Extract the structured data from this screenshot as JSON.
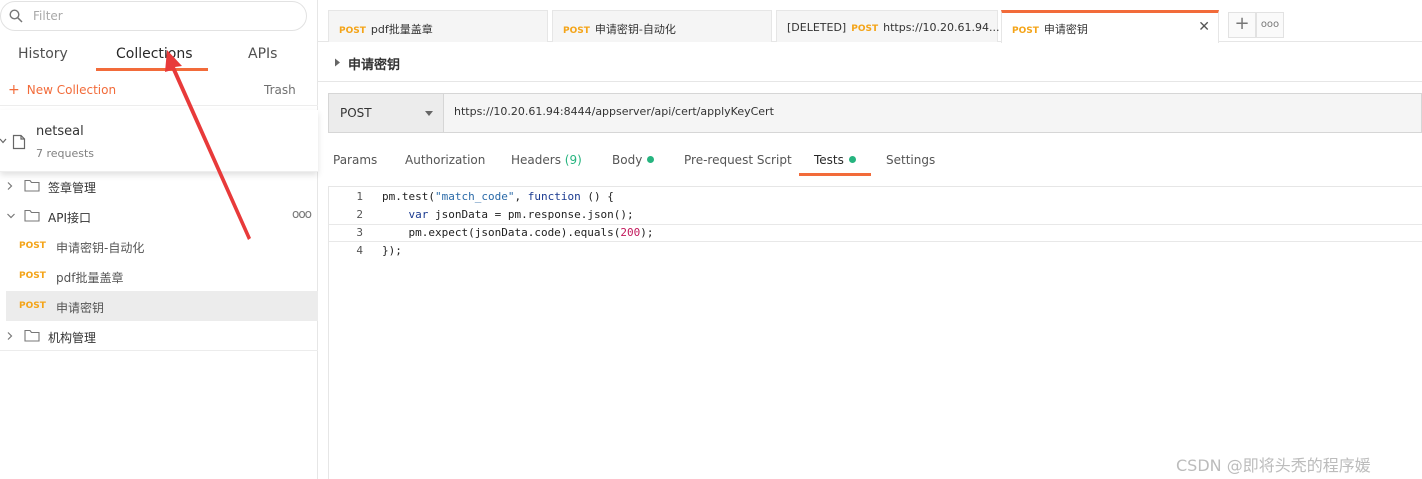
{
  "sidebar": {
    "filter_placeholder": "Filter",
    "tabs": [
      {
        "label": "History"
      },
      {
        "label": "Collections"
      },
      {
        "label": "APIs"
      }
    ],
    "new_collection_label": "New Collection",
    "trash_label": "Trash",
    "collection": {
      "name": "netseal",
      "count": "7 requests"
    },
    "tree": [
      {
        "label": "签章管理"
      },
      {
        "label": "API接口",
        "more": "ooo"
      },
      {
        "label": "机构管理"
      }
    ],
    "requests": [
      {
        "method": "POST",
        "label": "申请密钥-自动化"
      },
      {
        "method": "POST",
        "label": "pdf批量盖章"
      },
      {
        "method": "POST",
        "label": "申请密钥"
      }
    ]
  },
  "tabs": [
    {
      "prefix": "",
      "method": "POST",
      "label": "pdf批量盖章"
    },
    {
      "prefix": "",
      "method": "POST",
      "label": "申请密钥-自动化"
    },
    {
      "prefix": "[DELETED]",
      "method": "POST",
      "label": "https://10.20.61.94..."
    },
    {
      "prefix": "",
      "method": "POST",
      "label": "申请密钥"
    }
  ],
  "request": {
    "name": "申请密钥",
    "method": "POST",
    "url": "https://10.20.61.94:8444/appserver/api/cert/applyKeyCert"
  },
  "subtabs": {
    "params": "Params",
    "authorization": "Authorization",
    "headers": "Headers",
    "headers_count": "(9)",
    "body": "Body",
    "prerequest": "Pre-request Script",
    "tests": "Tests",
    "settings": "Settings"
  },
  "editor": {
    "line_numbers": [
      "1",
      "2",
      "3",
      "4"
    ],
    "l1": {
      "a": "pm.test(",
      "b": "\"match_code\"",
      "c": ", ",
      "d": "function",
      "e": " () {"
    },
    "l2": {
      "a": "    ",
      "b": "var",
      "c": " jsonData = pm.response.json();"
    },
    "l3": {
      "a": "    pm.expect(jsonData.code).equals(",
      "b": "200",
      "c": ");"
    },
    "l4": "});"
  },
  "watermark": "CSDN @即将头秃的程序媛",
  "colors": {
    "accent": "#f26b3a",
    "method": "#f4a418",
    "status_dot": "#26b47f"
  }
}
